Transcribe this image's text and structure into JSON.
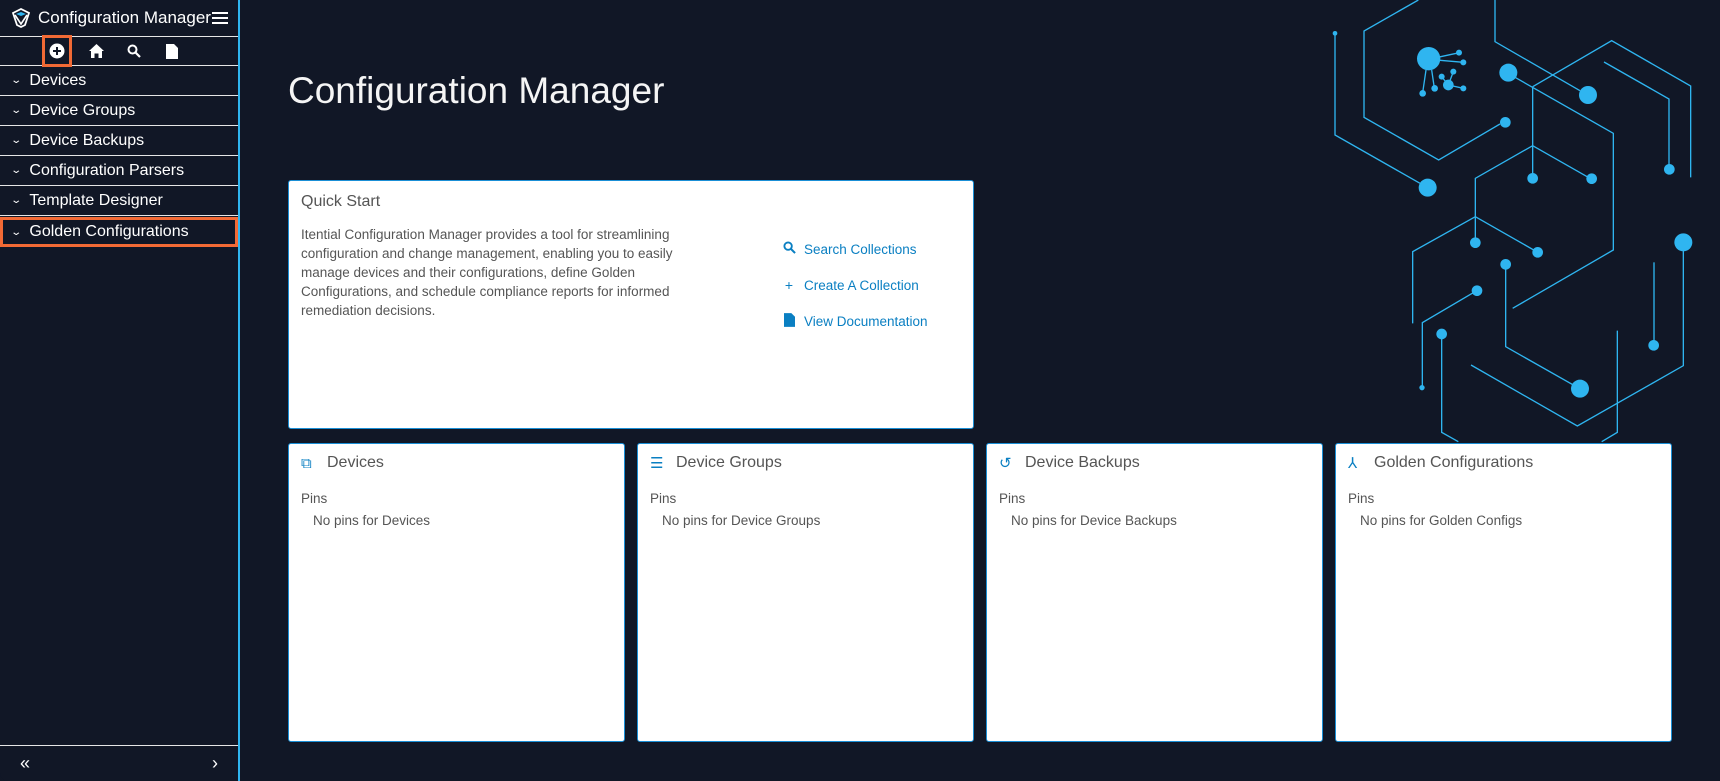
{
  "sidebar": {
    "app_title": "Configuration Manager",
    "items": [
      {
        "label": "Devices"
      },
      {
        "label": "Device Groups"
      },
      {
        "label": "Device Backups"
      },
      {
        "label": "Configuration Parsers"
      },
      {
        "label": "Template Designer"
      },
      {
        "label": "Golden Configurations"
      }
    ],
    "collapse_label": "«",
    "expand_label": "›"
  },
  "main": {
    "title": "Configuration Manager",
    "quick_start": {
      "title": "Quick Start",
      "description": "Itential Configuration Manager provides a tool for streamlining configuration and change management, enabling you to easily manage devices and their configurations, define Golden Configurations, and schedule compliance reports for informed remediation decisions.",
      "links": [
        {
          "label": "Search Collections"
        },
        {
          "label": "Create A Collection"
        },
        {
          "label": "View Documentation"
        }
      ]
    },
    "cards": [
      {
        "title": "Devices",
        "pins_label": "Pins",
        "empty": "No pins for Devices"
      },
      {
        "title": "Device Groups",
        "pins_label": "Pins",
        "empty": "No pins for Device Groups"
      },
      {
        "title": "Device Backups",
        "pins_label": "Pins",
        "empty": "No pins for Device Backups"
      },
      {
        "title": "Golden Configurations",
        "pins_label": "Pins",
        "empty": "No pins for Golden Configs"
      }
    ]
  },
  "colors": {
    "accent": "#2fb5f0",
    "link": "#0a7fc2",
    "highlight": "#f26a35",
    "background": "#111726"
  }
}
